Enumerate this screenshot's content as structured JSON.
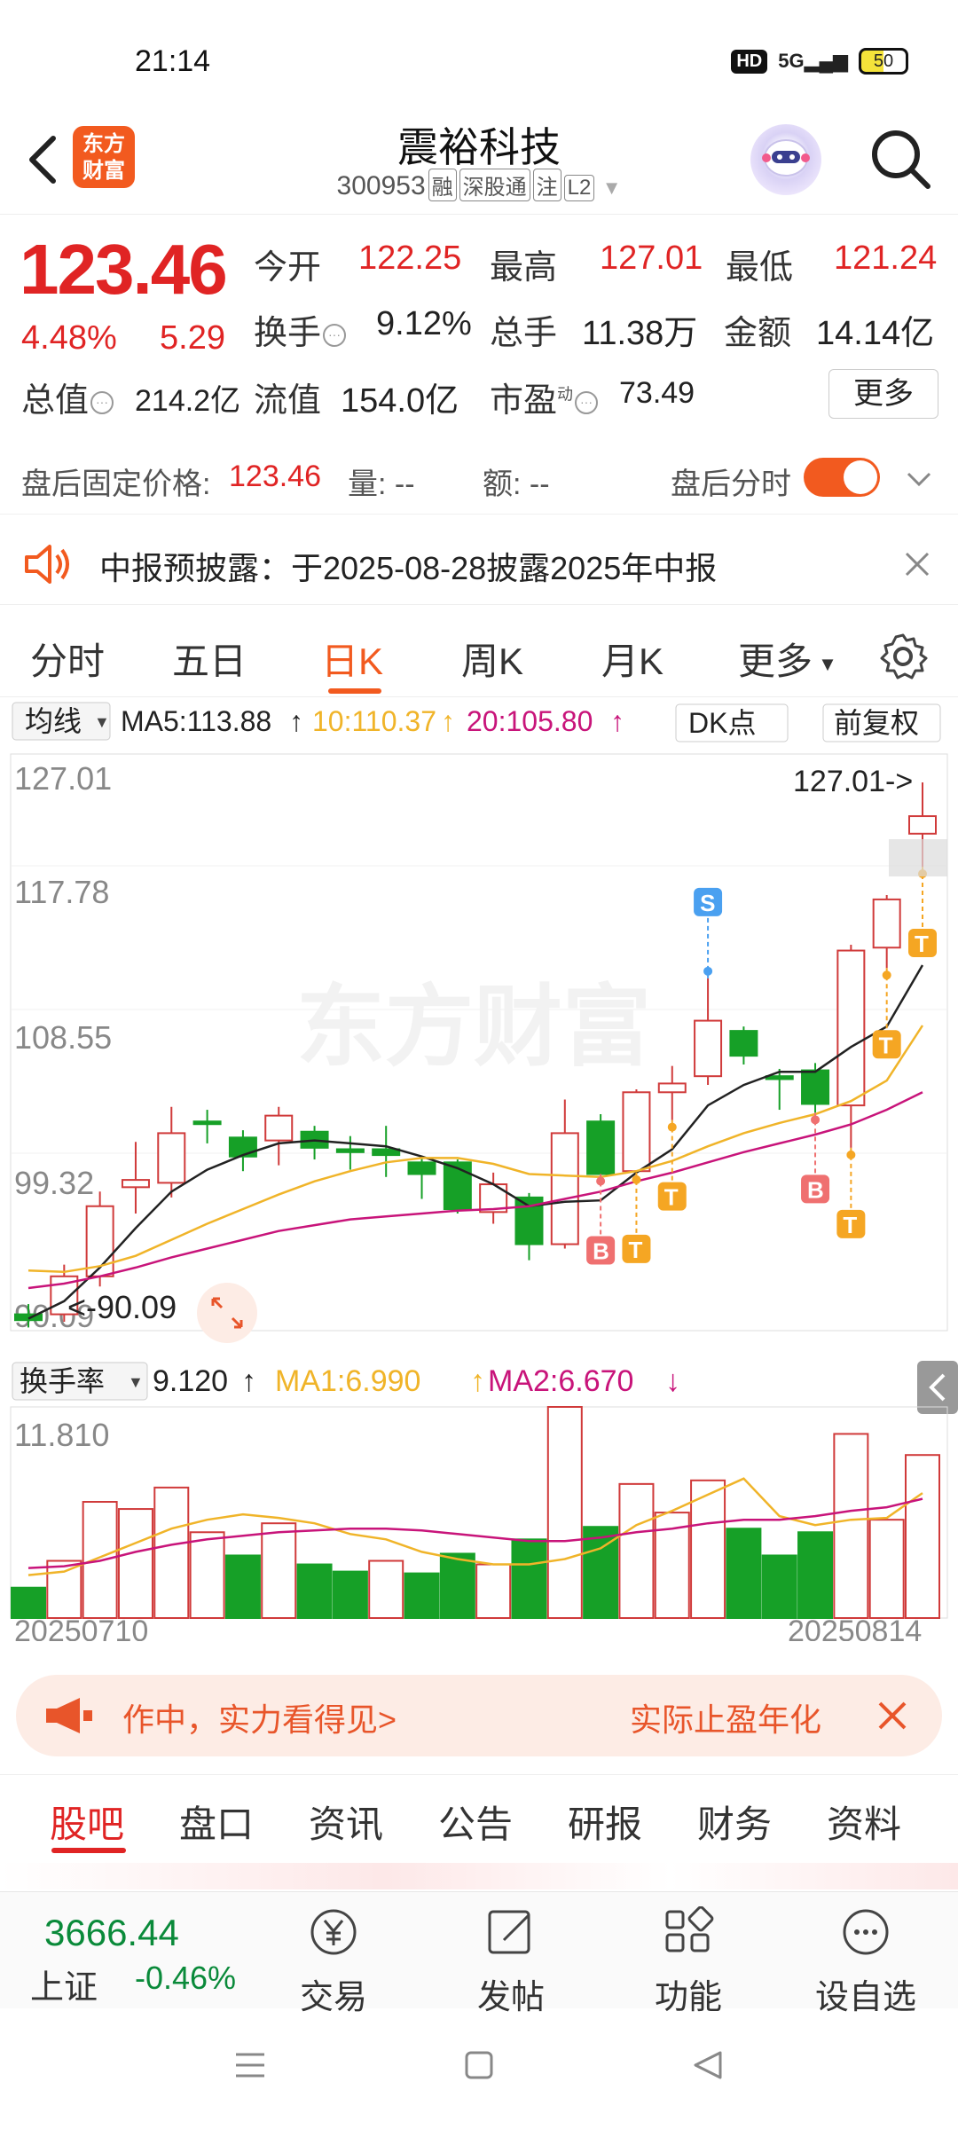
{
  "status_bar": {
    "time": "21:14",
    "hd": "HD",
    "network": "5G",
    "battery": "50"
  },
  "header": {
    "logo_line1": "东方",
    "logo_line2": "财富",
    "stock_name": "震裕科技",
    "stock_code": "300953",
    "tags": [
      "融",
      "深股通",
      "注",
      "L2"
    ]
  },
  "quote": {
    "last_price": "123.46",
    "change_pct": "4.48%",
    "change_amt": "5.29",
    "open_label": "今开",
    "open": "122.25",
    "high_label": "最高",
    "high": "127.01",
    "low_label": "最低",
    "low": "121.24",
    "turnover_label": "换手",
    "turnover": "9.12%",
    "volume_label": "总手",
    "volume": "11.38万",
    "amount_label": "金额",
    "amount": "14.14亿",
    "mktcap_label": "总值",
    "mktcap": "214.2亿",
    "float_label": "流值",
    "float_cap": "154.0亿",
    "pe_label": "市盈",
    "pe_super": "动",
    "pe": "73.49",
    "more_label": "更多"
  },
  "afterhours": {
    "price_label": "盘后固定价格:",
    "price": "123.46",
    "vol_label": "量: --",
    "amt_label": "额: --",
    "timeline_label": "盘后分时"
  },
  "notice": {
    "text": "中报预披露：于2025-08-28披露2025年中报"
  },
  "tabs": [
    "分时",
    "五日",
    "日K",
    "周K",
    "月K",
    "更多"
  ],
  "active_tab": "日K",
  "chart_data": [
    {
      "type": "candlestick",
      "indicator_label": "均线",
      "ma_labels": {
        "ma5": "MA5:113.88",
        "ma10": "10:110.37",
        "ma20": "20:105.80"
      },
      "dk_label": "DK点",
      "adjust_label": "前复权",
      "y_ticks": [
        "127.01",
        "117.78",
        "108.55",
        "99.32",
        "90.09"
      ],
      "y_range": [
        90.09,
        127.01
      ],
      "max_marker": "127.01->",
      "min_marker": "<-90.09",
      "watermark": "东方财富",
      "colors": {
        "up": "#d03a3a",
        "down": "#16a027",
        "ma5": "#222222",
        "ma10": "#f0b429",
        "ma20": "#c8147a"
      },
      "candles": [
        {
          "o": 90.6,
          "c": 90.2,
          "h": 91.3,
          "l": 89.7
        },
        {
          "o": 90.6,
          "c": 93.2,
          "h": 94.0,
          "l": 90.09
        },
        {
          "o": 93.2,
          "c": 98.0,
          "h": 99.0,
          "l": 92.5
        },
        {
          "o": 99.3,
          "c": 99.8,
          "h": 102.4,
          "l": 97.5
        },
        {
          "o": 99.6,
          "c": 103.0,
          "h": 104.8,
          "l": 98.6
        },
        {
          "o": 103.8,
          "c": 103.7,
          "h": 104.6,
          "l": 102.3
        },
        {
          "o": 102.7,
          "c": 101.4,
          "h": 103.2,
          "l": 100.4
        },
        {
          "o": 102.5,
          "c": 104.2,
          "h": 104.8,
          "l": 100.8
        },
        {
          "o": 103.1,
          "c": 102.0,
          "h": 103.5,
          "l": 101.2
        },
        {
          "o": 101.9,
          "c": 101.7,
          "h": 102.8,
          "l": 100.5
        },
        {
          "o": 101.9,
          "c": 101.5,
          "h": 103.5,
          "l": 100.0
        },
        {
          "o": 101.0,
          "c": 100.2,
          "h": 101.4,
          "l": 98.5
        },
        {
          "o": 101.0,
          "c": 97.8,
          "h": 101.2,
          "l": 97.5
        },
        {
          "o": 97.6,
          "c": 99.5,
          "h": 100.3,
          "l": 96.8
        },
        {
          "o": 98.6,
          "c": 95.4,
          "h": 98.9,
          "l": 94.3
        },
        {
          "o": 95.4,
          "c": 103.0,
          "h": 105.3,
          "l": 95.1
        },
        {
          "o": 103.8,
          "c": 100.2,
          "h": 104.3,
          "l": 99.8
        },
        {
          "o": 100.4,
          "c": 105.8,
          "h": 106.0,
          "l": 100.3
        },
        {
          "o": 105.8,
          "c": 106.4,
          "h": 107.6,
          "l": 103.9
        },
        {
          "o": 106.9,
          "c": 110.7,
          "h": 113.6,
          "l": 106.3
        },
        {
          "o": 110.0,
          "c": 108.3,
          "h": 110.3,
          "l": 107.7
        },
        {
          "o": 106.9,
          "c": 106.7,
          "h": 107.4,
          "l": 104.6
        },
        {
          "o": 107.3,
          "c": 105.0,
          "h": 107.8,
          "l": 104.4
        },
        {
          "o": 104.9,
          "c": 115.5,
          "h": 115.9,
          "l": 102.0
        },
        {
          "o": 115.7,
          "c": 119.0,
          "h": 119.3,
          "l": 114.3
        },
        {
          "o": 123.5,
          "c": 124.7,
          "h": 127.01,
          "l": 121.24
        }
      ],
      "ma5": [
        90.3,
        91.5,
        93.8,
        96.5,
        99.0,
        100.5,
        101.5,
        102.3,
        102.5,
        102.3,
        102.1,
        101.4,
        100.6,
        99.5,
        98.0,
        98.3,
        98.4,
        100.3,
        101.9,
        104.9,
        106.3,
        107.2,
        107.2,
        108.9,
        110.3,
        114.5
      ],
      "ma10": [
        93.6,
        93.5,
        93.9,
        94.6,
        95.7,
        96.8,
        97.8,
        98.8,
        99.7,
        100.4,
        101.0,
        101.3,
        101.3,
        100.9,
        100.2,
        100.1,
        100.0,
        100.4,
        101.1,
        102.1,
        103.0,
        103.7,
        104.3,
        105.2,
        106.6,
        110.37
      ],
      "ma20": [
        92.4,
        92.7,
        93.2,
        93.8,
        94.5,
        95.1,
        95.7,
        96.3,
        96.7,
        97.1,
        97.3,
        97.5,
        97.7,
        97.8,
        98.0,
        98.5,
        99.0,
        99.7,
        100.3,
        101.0,
        101.7,
        102.3,
        102.9,
        103.6,
        104.6,
        105.8
      ],
      "signals": [
        {
          "i": 16,
          "type": "B",
          "at": 100.2
        },
        {
          "i": 17,
          "type": "T",
          "at": 100.3
        },
        {
          "i": 18,
          "type": "T",
          "at": 103.9
        },
        {
          "i": 19,
          "type": "S",
          "at": 113.6
        },
        {
          "i": 22,
          "type": "B",
          "at": 104.4
        },
        {
          "i": 23,
          "type": "T",
          "at": 102.0
        },
        {
          "i": 24,
          "type": "T",
          "at": 114.3
        },
        {
          "i": 25,
          "type": "T",
          "at": 121.24
        }
      ]
    },
    {
      "type": "bar",
      "indicator_label": "换手率",
      "value_label": "9.120",
      "ma1_label": "MA1:6.990",
      "ma2_label": "MA2:6.670",
      "y_tick": "11.810",
      "y_range": [
        0,
        11.81
      ],
      "start_date": "20250710",
      "end_date": "20250814",
      "values": [
        1.7,
        3.2,
        6.5,
        6.1,
        7.3,
        4.8,
        3.5,
        5.3,
        3.0,
        2.6,
        3.2,
        2.5,
        3.6,
        3.0,
        4.4,
        11.81,
        5.1,
        7.5,
        5.9,
        7.7,
        5.0,
        3.5,
        4.8,
        10.3,
        5.5,
        9.12
      ],
      "up": [
        false,
        true,
        true,
        true,
        true,
        true,
        false,
        true,
        false,
        false,
        true,
        false,
        false,
        true,
        false,
        true,
        false,
        true,
        true,
        true,
        false,
        false,
        false,
        true,
        true,
        true
      ],
      "ma1": [
        2.4,
        2.6,
        3.4,
        4.2,
        5.0,
        5.5,
        5.8,
        5.6,
        5.3,
        4.7,
        4.4,
        3.7,
        3.3,
        3.0,
        3.0,
        3.3,
        3.9,
        5.2,
        6.0,
        6.9,
        7.8,
        5.7,
        5.2,
        5.5,
        5.6,
        6.99
      ],
      "ma2": [
        2.8,
        2.9,
        3.2,
        3.7,
        4.1,
        4.4,
        4.6,
        4.8,
        4.9,
        5.0,
        5.0,
        4.9,
        4.7,
        4.5,
        4.3,
        4.3,
        4.5,
        4.8,
        5.0,
        5.3,
        5.5,
        5.5,
        5.7,
        6.0,
        6.2,
        6.67
      ]
    }
  ],
  "ad_banner": {
    "left_text": "作中，实力看得见>",
    "right_text": "实际止盈年化"
  },
  "bottom_tabs": [
    "股吧",
    "盘口",
    "资讯",
    "公告",
    "研报",
    "财务",
    "资料"
  ],
  "active_bottom_tab": "股吧",
  "index": {
    "value": "3666.44",
    "name": "上证",
    "change": "-0.46%"
  },
  "toolbar": [
    "交易",
    "发帖",
    "功能",
    "设自选"
  ]
}
